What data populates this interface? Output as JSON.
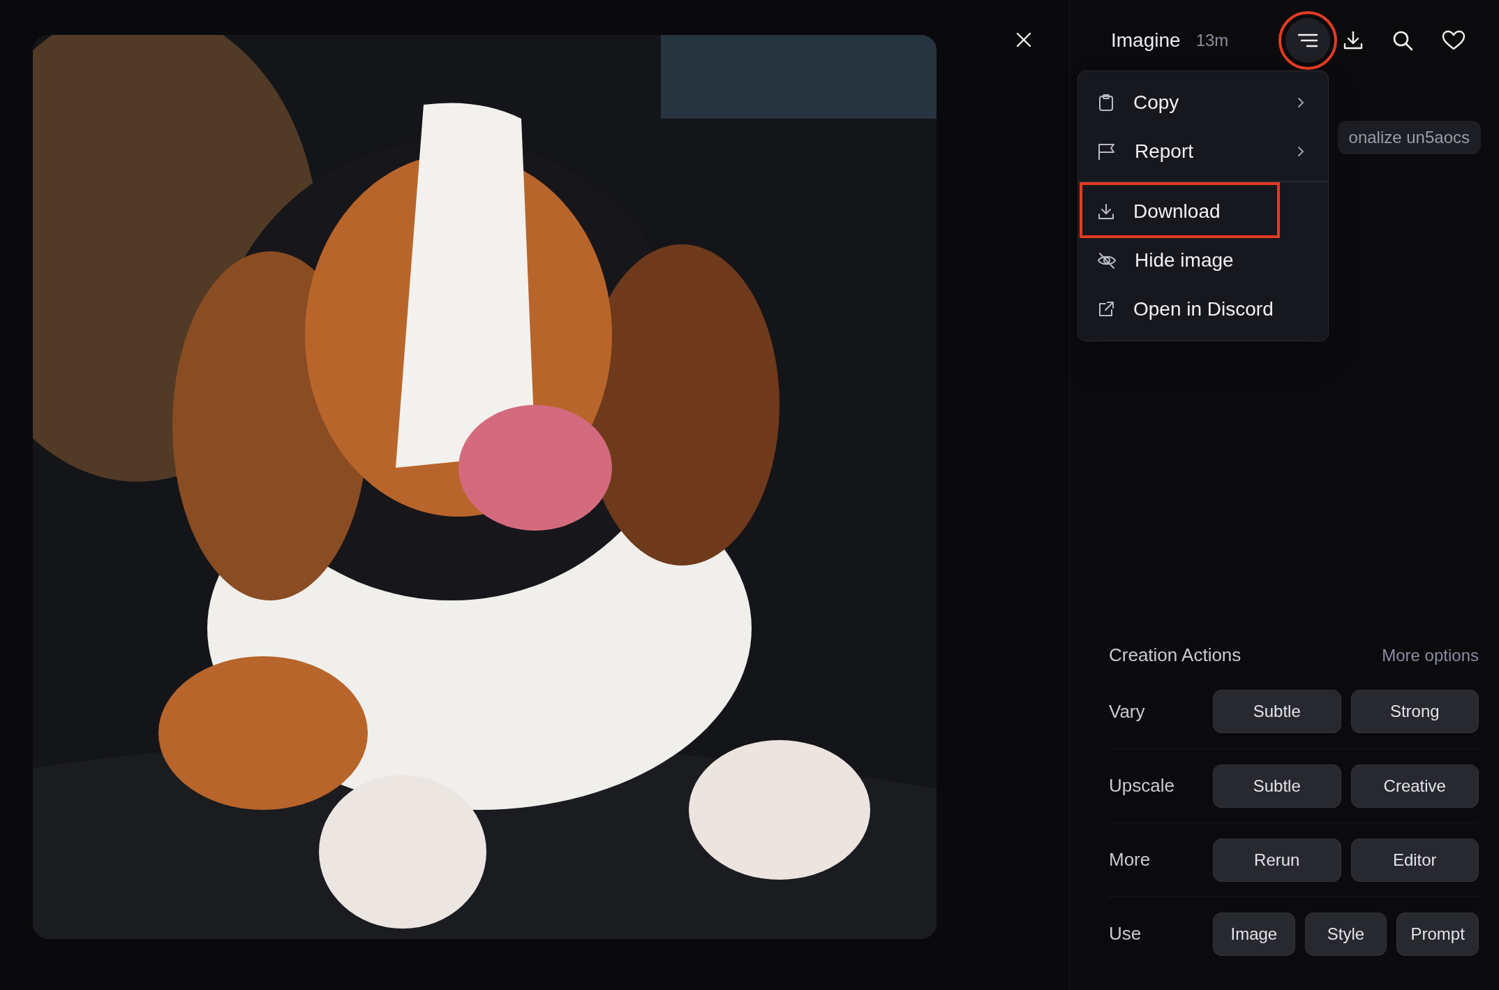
{
  "header": {
    "title": "Imagine",
    "time": "13m",
    "menu_button": {
      "open": true,
      "highlighted": true
    }
  },
  "tag": "onalize un5aocs",
  "menu": {
    "groups": [
      [
        {
          "label": "Copy",
          "has_submenu": true,
          "highlighted": false
        },
        {
          "label": "Report",
          "has_submenu": true,
          "highlighted": false
        }
      ],
      [
        {
          "label": "Download",
          "has_submenu": false,
          "highlighted": true
        },
        {
          "label": "Hide image",
          "has_submenu": false,
          "highlighted": false
        },
        {
          "label": "Open in Discord",
          "has_submenu": false,
          "highlighted": false
        }
      ]
    ]
  },
  "creation_actions": {
    "title": "Creation Actions",
    "more_link": "More options",
    "rows": [
      {
        "label": "Vary",
        "buttons": [
          "Subtle",
          "Strong"
        ]
      },
      {
        "label": "Upscale",
        "buttons": [
          "Subtle",
          "Creative"
        ]
      },
      {
        "label": "More",
        "buttons": [
          "Rerun",
          "Editor"
        ]
      },
      {
        "label": "Use",
        "buttons": [
          "Image",
          "Style",
          "Prompt"
        ]
      }
    ]
  }
}
